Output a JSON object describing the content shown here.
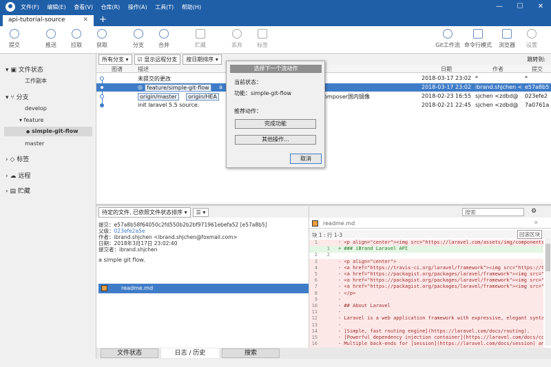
{
  "menu": [
    "文件(F)",
    "编辑(E)",
    "查看(V)",
    "仓库(R)",
    "操作(A)",
    "工具(T)",
    "帮助(H)"
  ],
  "window": {
    "min": "—",
    "max": "☐",
    "close": "✕"
  },
  "tab": {
    "title": "api-tutorial-source",
    "close": "✕",
    "plus": "+"
  },
  "toolbar": {
    "commit": "提交",
    "push": "推送",
    "pull": "拉取",
    "fetch": "获取",
    "branch": "分支",
    "merge": "合并",
    "stash": "贮藏",
    "discard": "丢弃",
    "tag": "标签",
    "gitflow": "Git工作流",
    "terminal": "命令行模式",
    "explorer": "浏览器",
    "settings": "设置"
  },
  "sidebar": {
    "file_status": "文件状态",
    "working_copy": "工作副本",
    "branches": "分支",
    "develop": "develop",
    "feature": "feature",
    "current_branch": "simple-git-flow",
    "master": "master",
    "tags": "标签",
    "remotes": "远程",
    "stashes": "贮藏"
  },
  "filters": {
    "branches": "所有分支",
    "show_remote": "显示远程分支",
    "sort": "按日期排序",
    "jump": "跳转到:"
  },
  "columns": {
    "graph": "图谱",
    "desc": "描述",
    "date": "日期",
    "author": "作者",
    "commit": "提交"
  },
  "commits": [
    {
      "desc": "未提交的更改",
      "badges": [],
      "date": "2018-03-17 23:02",
      "author": "*",
      "hash": "*"
    },
    {
      "desc": "a",
      "badges": [
        "feature/simple-git-flow"
      ],
      "date": "2018-03-17 23:02",
      "author": "ibrand.shjchen <",
      "hash": "e57a8b5"
    },
    {
      "desc": "omposer国内镜像",
      "badges": [
        "origin/master",
        "origin/HEA"
      ],
      "date": "2018-02-23 16:55",
      "author": "sjchen <zdbd@",
      "hash": "023efe2"
    },
    {
      "desc": "init laravel 5.5 source.",
      "badges": [],
      "date": "2018-02-21 22:45",
      "author": "sjchen <zdbd@",
      "hash": "7a0761a"
    }
  ],
  "dialog": {
    "title": "选择下一个流动作",
    "current_state_label": "当前状态：",
    "function_line": "功能：simple-git-flow",
    "recommended": "推荐动作：",
    "finish": "完成功能",
    "other": "其他操作...",
    "cancel": "取消"
  },
  "lower": {
    "file_filter": "待定的文件, 已依照文件状态排序",
    "list_icon": "☰",
    "commit_label": "提交：",
    "commit_full": "e57a8b58f64050c2fd550b2b2bf971961ebefa52 [e57a8b5]",
    "parent_label": "父级：",
    "parent": "023efe2a5e",
    "author_label": "作者：",
    "author": "ibrand.shjchen <ibrand.shjchen@foxmail.com>",
    "date_label": "日期：",
    "date": "2018年3月17日 23:02:40",
    "committer_label": "提交者：",
    "committer": "ibrand.shjchen",
    "message": "a simple git flow.",
    "file": "readme.md"
  },
  "diff": {
    "search_placeholder": "搜索",
    "gear": "⚙",
    "filename": "readme.md",
    "hunk": "块 1 : 行 1-3",
    "revert": "回滚区块",
    "lines": [
      {
        "a": "1",
        "b": "",
        "type": "del",
        "text": "- <p align=\"center\"><img src=\"https://laravel.com/assets/img/components/l"
      },
      {
        "a": "",
        "b": "1",
        "type": "add",
        "text": "+ ### iBrand Laravel API"
      },
      {
        "a": "2",
        "b": "2",
        "type": "ctx",
        "text": ""
      },
      {
        "a": "3",
        "b": "",
        "type": "del",
        "text": "- <p align=\"center\">"
      },
      {
        "a": "4",
        "b": "",
        "type": "del",
        "text": "- <a href=\"https://travis-ci.org/laravel/framework\"><img src=\"https://tra"
      },
      {
        "a": "5",
        "b": "",
        "type": "del",
        "text": "- <a href=\"https://packagist.org/packages/laravel/framework\"><img src=\"ht"
      },
      {
        "a": "6",
        "b": "",
        "type": "del",
        "text": "- <a href=\"https://packagist.org/packages/laravel/framework\"><img src=\"ht"
      },
      {
        "a": "7",
        "b": "",
        "type": "del",
        "text": "- <a href=\"https://packagist.org/packages/laravel/framework\"><img src=\"ht"
      },
      {
        "a": "8",
        "b": "",
        "type": "del",
        "text": "- </p>"
      },
      {
        "a": "9",
        "b": "",
        "type": "del",
        "text": "-"
      },
      {
        "a": "10",
        "b": "",
        "type": "del",
        "text": "- ## About Laravel"
      },
      {
        "a": "11",
        "b": "",
        "type": "del",
        "text": "-"
      },
      {
        "a": "12",
        "b": "",
        "type": "del",
        "text": "- Laravel is a web application framework with expressive, elegant syntax."
      },
      {
        "a": "13",
        "b": "",
        "type": "del",
        "text": "-"
      },
      {
        "a": "14",
        "b": "",
        "type": "del",
        "text": "- [Simple, fast routing engine](https://laravel.com/docs/routing)."
      },
      {
        "a": "15",
        "b": "",
        "type": "del",
        "text": "- [Powerful dependency injection container](https://laravel.com/docs/cont"
      },
      {
        "a": "16",
        "b": "",
        "type": "del",
        "text": "- Multiple back-ends for [session](https://laravel.com/docs/session) an"
      }
    ]
  },
  "bottom_tabs": {
    "status": "文件状态",
    "log": "日志 / 历史",
    "search": "搜索"
  }
}
